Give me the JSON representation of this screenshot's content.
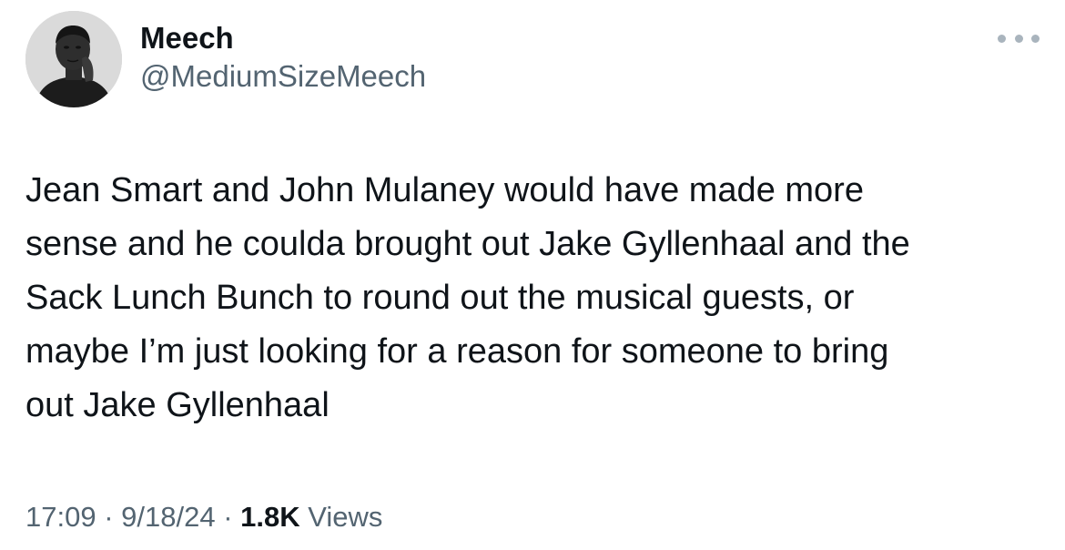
{
  "author": {
    "display_name": "Meech",
    "handle": "@MediumSizeMeech"
  },
  "tweet": {
    "lines": [
      "Jean Smart and John Mulaney would have made more",
      "sense and he coulda brought out Jake Gyllenhaal and the",
      "Sack Lunch Bunch to round out the musical guests, or",
      "maybe I’m just looking for a reason for someone to bring",
      "out Jake Gyllenhaal"
    ]
  },
  "meta": {
    "time": "17:09",
    "separator": " · ",
    "date": "9/18/24",
    "views_count": "1.8K",
    "views_label": " Views"
  },
  "icons": {
    "more": "more-horizontal-icon",
    "avatar": "profile-photo"
  },
  "colors": {
    "text_primary": "#0f1419",
    "text_secondary": "#536471",
    "more_dots": "#a9b4bd",
    "background": "#ffffff"
  }
}
